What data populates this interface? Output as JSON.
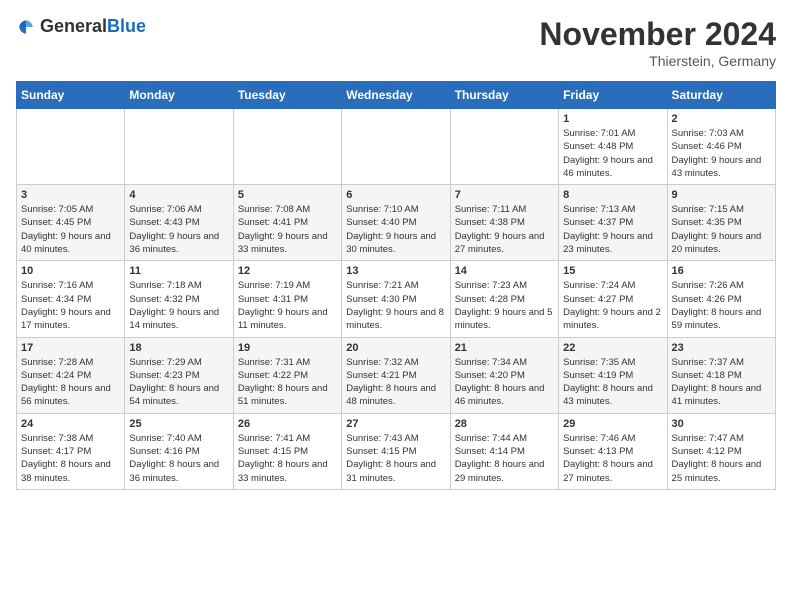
{
  "logo": {
    "general": "General",
    "blue": "Blue"
  },
  "header": {
    "month": "November 2024",
    "location": "Thierstein, Germany"
  },
  "weekdays": [
    "Sunday",
    "Monday",
    "Tuesday",
    "Wednesday",
    "Thursday",
    "Friday",
    "Saturday"
  ],
  "weeks": [
    [
      {
        "day": "",
        "info": ""
      },
      {
        "day": "",
        "info": ""
      },
      {
        "day": "",
        "info": ""
      },
      {
        "day": "",
        "info": ""
      },
      {
        "day": "",
        "info": ""
      },
      {
        "day": "1",
        "info": "Sunrise: 7:01 AM\nSunset: 4:48 PM\nDaylight: 9 hours and 46 minutes."
      },
      {
        "day": "2",
        "info": "Sunrise: 7:03 AM\nSunset: 4:46 PM\nDaylight: 9 hours and 43 minutes."
      }
    ],
    [
      {
        "day": "3",
        "info": "Sunrise: 7:05 AM\nSunset: 4:45 PM\nDaylight: 9 hours and 40 minutes."
      },
      {
        "day": "4",
        "info": "Sunrise: 7:06 AM\nSunset: 4:43 PM\nDaylight: 9 hours and 36 minutes."
      },
      {
        "day": "5",
        "info": "Sunrise: 7:08 AM\nSunset: 4:41 PM\nDaylight: 9 hours and 33 minutes."
      },
      {
        "day": "6",
        "info": "Sunrise: 7:10 AM\nSunset: 4:40 PM\nDaylight: 9 hours and 30 minutes."
      },
      {
        "day": "7",
        "info": "Sunrise: 7:11 AM\nSunset: 4:38 PM\nDaylight: 9 hours and 27 minutes."
      },
      {
        "day": "8",
        "info": "Sunrise: 7:13 AM\nSunset: 4:37 PM\nDaylight: 9 hours and 23 minutes."
      },
      {
        "day": "9",
        "info": "Sunrise: 7:15 AM\nSunset: 4:35 PM\nDaylight: 9 hours and 20 minutes."
      }
    ],
    [
      {
        "day": "10",
        "info": "Sunrise: 7:16 AM\nSunset: 4:34 PM\nDaylight: 9 hours and 17 minutes."
      },
      {
        "day": "11",
        "info": "Sunrise: 7:18 AM\nSunset: 4:32 PM\nDaylight: 9 hours and 14 minutes."
      },
      {
        "day": "12",
        "info": "Sunrise: 7:19 AM\nSunset: 4:31 PM\nDaylight: 9 hours and 11 minutes."
      },
      {
        "day": "13",
        "info": "Sunrise: 7:21 AM\nSunset: 4:30 PM\nDaylight: 9 hours and 8 minutes."
      },
      {
        "day": "14",
        "info": "Sunrise: 7:23 AM\nSunset: 4:28 PM\nDaylight: 9 hours and 5 minutes."
      },
      {
        "day": "15",
        "info": "Sunrise: 7:24 AM\nSunset: 4:27 PM\nDaylight: 9 hours and 2 minutes."
      },
      {
        "day": "16",
        "info": "Sunrise: 7:26 AM\nSunset: 4:26 PM\nDaylight: 8 hours and 59 minutes."
      }
    ],
    [
      {
        "day": "17",
        "info": "Sunrise: 7:28 AM\nSunset: 4:24 PM\nDaylight: 8 hours and 56 minutes."
      },
      {
        "day": "18",
        "info": "Sunrise: 7:29 AM\nSunset: 4:23 PM\nDaylight: 8 hours and 54 minutes."
      },
      {
        "day": "19",
        "info": "Sunrise: 7:31 AM\nSunset: 4:22 PM\nDaylight: 8 hours and 51 minutes."
      },
      {
        "day": "20",
        "info": "Sunrise: 7:32 AM\nSunset: 4:21 PM\nDaylight: 8 hours and 48 minutes."
      },
      {
        "day": "21",
        "info": "Sunrise: 7:34 AM\nSunset: 4:20 PM\nDaylight: 8 hours and 46 minutes."
      },
      {
        "day": "22",
        "info": "Sunrise: 7:35 AM\nSunset: 4:19 PM\nDaylight: 8 hours and 43 minutes."
      },
      {
        "day": "23",
        "info": "Sunrise: 7:37 AM\nSunset: 4:18 PM\nDaylight: 8 hours and 41 minutes."
      }
    ],
    [
      {
        "day": "24",
        "info": "Sunrise: 7:38 AM\nSunset: 4:17 PM\nDaylight: 8 hours and 38 minutes."
      },
      {
        "day": "25",
        "info": "Sunrise: 7:40 AM\nSunset: 4:16 PM\nDaylight: 8 hours and 36 minutes."
      },
      {
        "day": "26",
        "info": "Sunrise: 7:41 AM\nSunset: 4:15 PM\nDaylight: 8 hours and 33 minutes."
      },
      {
        "day": "27",
        "info": "Sunrise: 7:43 AM\nSunset: 4:15 PM\nDaylight: 8 hours and 31 minutes."
      },
      {
        "day": "28",
        "info": "Sunrise: 7:44 AM\nSunset: 4:14 PM\nDaylight: 8 hours and 29 minutes."
      },
      {
        "day": "29",
        "info": "Sunrise: 7:46 AM\nSunset: 4:13 PM\nDaylight: 8 hours and 27 minutes."
      },
      {
        "day": "30",
        "info": "Sunrise: 7:47 AM\nSunset: 4:12 PM\nDaylight: 8 hours and 25 minutes."
      }
    ]
  ]
}
